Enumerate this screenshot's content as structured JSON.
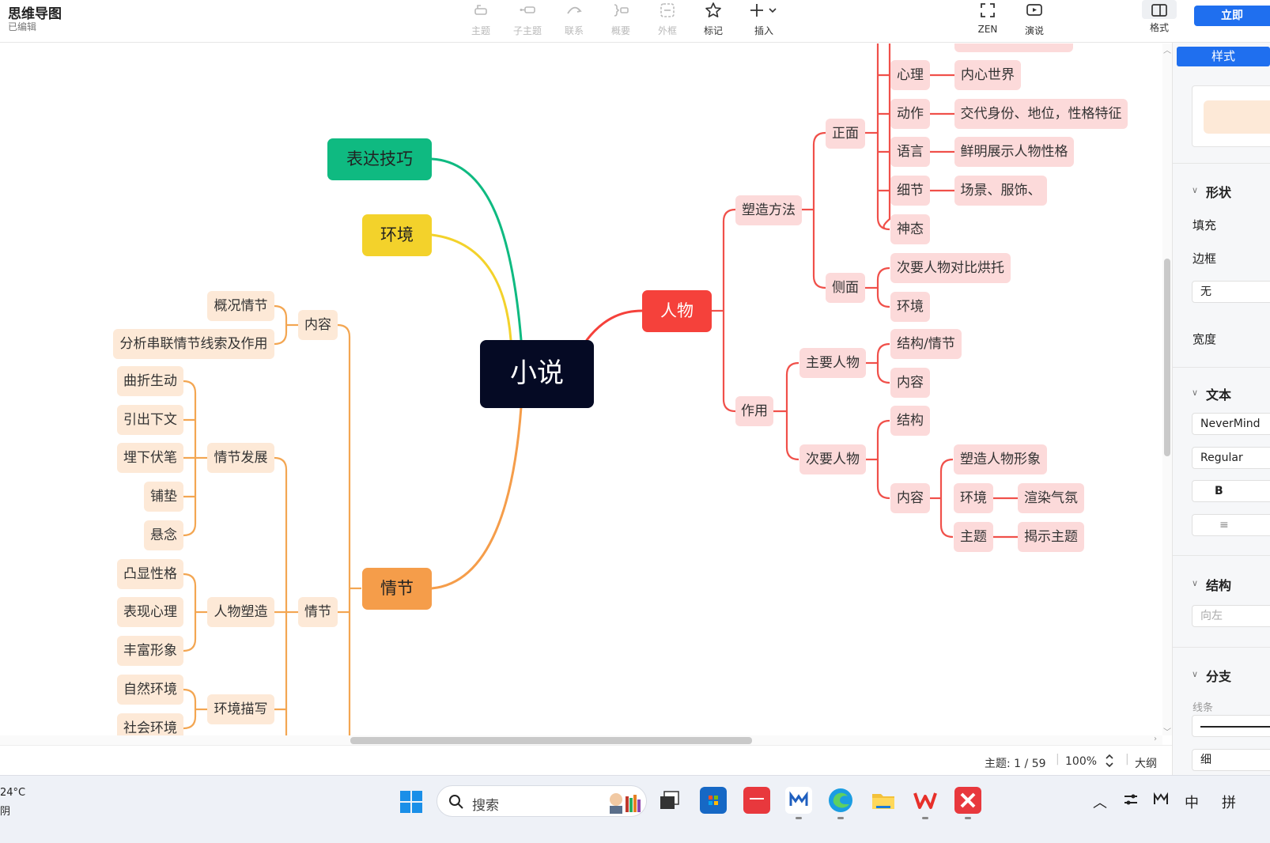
{
  "app": {
    "title": "思维导图",
    "subtitle": "已编辑"
  },
  "toolbar": {
    "items": [
      {
        "label": "主题",
        "icon": "topic-icon",
        "enabled": false
      },
      {
        "label": "子主题",
        "icon": "subtopic-icon",
        "enabled": false
      },
      {
        "label": "联系",
        "icon": "relationship-icon",
        "enabled": false
      },
      {
        "label": "概要",
        "icon": "summary-icon",
        "enabled": false
      },
      {
        "label": "外框",
        "icon": "boundary-icon",
        "enabled": false
      },
      {
        "label": "标记",
        "icon": "star-icon",
        "enabled": true
      },
      {
        "label": "插入",
        "icon": "plus-icon",
        "enabled": true
      },
      {
        "label": "ZEN",
        "icon": "fullscreen-icon",
        "enabled": true
      },
      {
        "label": "演说",
        "icon": "play-icon",
        "enabled": true
      },
      {
        "label": "格式",
        "icon": "panel-icon",
        "enabled": true
      }
    ],
    "cta_label": "立即"
  },
  "mindmap": {
    "root": "小说",
    "colors": {
      "root": "#050a24",
      "green": "#0fba81",
      "yellow": "#f3d22b",
      "orange": "#f59d4a",
      "red": "#f5413b",
      "red_light": "#fcdada",
      "orange_light": "#fde9d7",
      "red_line": "#f0504a",
      "orange_line": "#f3a652"
    },
    "branches": {
      "expression": "表达技巧",
      "environment": "环境",
      "plot": "情节",
      "character": "人物"
    },
    "character": {
      "methods": "塑造方法",
      "front": "正面",
      "front_items": [
        {
          "label": "心理",
          "detail": "内心世界"
        },
        {
          "label": "动作",
          "detail": "交代身份、地位，性格特征"
        },
        {
          "label": "语言",
          "detail": "鲜明展示人物性格"
        },
        {
          "label": "细节",
          "detail": "场景、服饰、"
        },
        {
          "label": "神态",
          "detail": ""
        }
      ],
      "side": "侧面",
      "side_items": [
        "次要人物对比烘托",
        "环境"
      ],
      "function": "作用",
      "main_char": "主要人物",
      "main_items": [
        "结构/情节",
        "内容"
      ],
      "minor_char": "次要人物",
      "minor_structure": "结构",
      "minor_content": "内容",
      "minor_content_items": [
        {
          "label": "塑造人物形象",
          "detail": ""
        },
        {
          "label": "环境",
          "detail": "渲染气氛"
        },
        {
          "label": "主题",
          "detail": "揭示主题"
        }
      ]
    },
    "plot": {
      "content": "内容",
      "content_items": [
        "概况情节",
        "分析串联情节线索及作用"
      ],
      "plot_sub": "情节",
      "development": "情节发展",
      "development_items": [
        "曲折生动",
        "引出下文",
        "埋下伏笔",
        "铺垫",
        "悬念"
      ],
      "shaping": "人物塑造",
      "shaping_items": [
        "凸显性格",
        "表现心理",
        "丰富形象"
      ],
      "env_desc": "环境描写",
      "env_items": [
        "自然环境",
        "社会环境"
      ]
    }
  },
  "status": {
    "topic_count": "主题: 1 / 59",
    "zoom": "100%",
    "outline": "大纲"
  },
  "panel": {
    "tab": "样式",
    "shape": {
      "title": "形状",
      "fill": "填充",
      "border": "边框",
      "border_value": "无",
      "width": "宽度"
    },
    "text": {
      "title": "文本",
      "font": "NeverMind",
      "weight": "Regular",
      "bold": "B"
    },
    "structure": {
      "title": "结构",
      "value": "向左"
    },
    "branch": {
      "title": "分支",
      "line": "线条",
      "thickness": "细"
    }
  },
  "taskbar": {
    "weather_temp": "24°C",
    "weather_desc": "阴",
    "search_placeholder": "搜索",
    "tray": {
      "ime_zh": "中",
      "ime_pinyin": "拼"
    }
  }
}
